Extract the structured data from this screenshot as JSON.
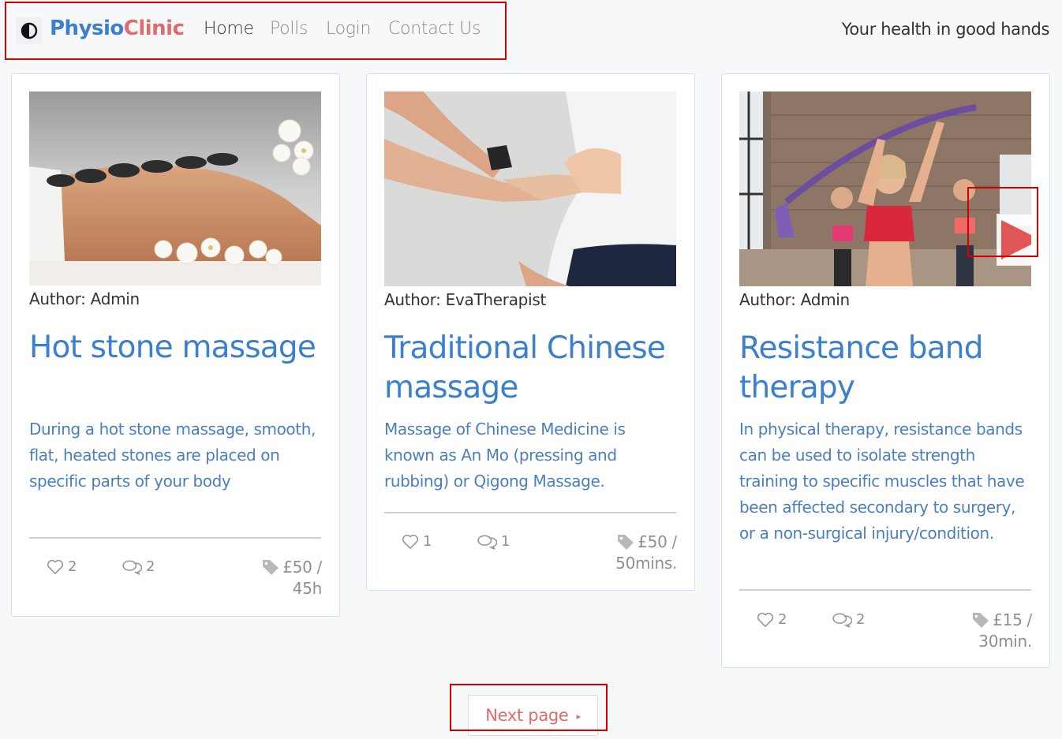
{
  "brand": {
    "part1": "Physio",
    "part2": "Clinic"
  },
  "nav": {
    "home": "Home",
    "polls": "Polls",
    "login": "Login",
    "contact": "Contact Us"
  },
  "tagline": "Your health in good hands",
  "cards": [
    {
      "author": "Author: Admin",
      "title": "Hot stone massage",
      "description": "During a hot stone massage, smooth, flat, heated stones are placed on specific parts of your body",
      "likes": "2",
      "comments": "2",
      "price_line1": "£50 /",
      "price_line2": "45h"
    },
    {
      "author": "Author: EvaTherapist",
      "title": "Traditional Chinese massage",
      "description": "Massage of Chinese Medicine is known as An Mo (pressing and rubbing) or Qigong Massage.",
      "likes": "1",
      "comments": "1",
      "price_line1": "£50 /",
      "price_line2": "50mins."
    },
    {
      "author": "Author: Admin",
      "title": "Resistance band therapy",
      "description": "In physical therapy, resistance bands can be used to isolate strength training to specific muscles that have been affected secondary to surgery, or a non-surgical injury/condition.",
      "likes": "2",
      "comments": "2",
      "price_line1": "£15 /",
      "price_line2": "30min."
    }
  ],
  "pagination": {
    "next_label": "Next page",
    "next_arrow": "▸"
  },
  "colors": {
    "primary": "#3b7fcf",
    "accent": "#e06b6b",
    "highlight": "#d40000"
  }
}
